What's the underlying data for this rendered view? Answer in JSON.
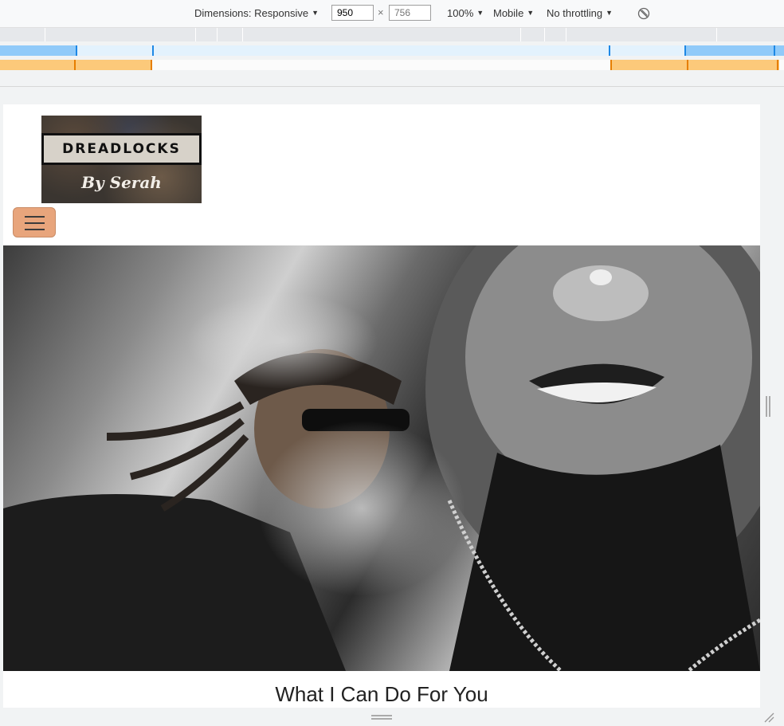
{
  "toolbar": {
    "dimensions_label": "Dimensions: Responsive",
    "width_value": "950",
    "height_placeholder": "756",
    "times": "×",
    "zoom": "100%",
    "device_type": "Mobile",
    "throttling": "No throttling",
    "dropdown_icon": "dropdown-arrow-icon",
    "rotate_icon": "rotate-icon"
  },
  "page": {
    "logo_title": "DREADLOCKS",
    "logo_subtitle": "By Serah",
    "menu_icon": "hamburger-menu-icon",
    "hero_alt": "Man with dreadlocks exhaling smoke in front of a mural",
    "section_title": "What I Can Do For You"
  },
  "colors": {
    "menu_button": "#e8a57c",
    "mq_blue": "#90caf9",
    "mq_orange": "#fcc97a"
  }
}
